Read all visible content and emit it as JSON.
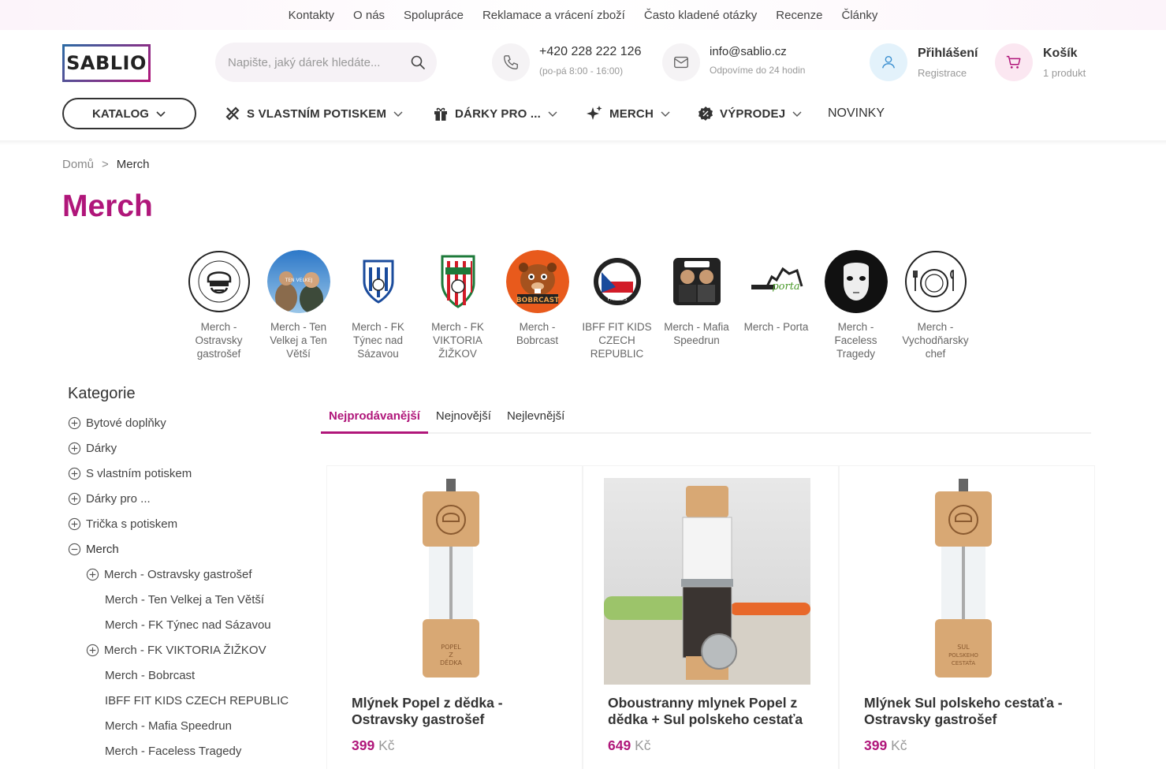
{
  "topbar": {
    "links": [
      "Kontakty",
      "O nás",
      "Spolupráce",
      "Reklamace a vrácení zboží",
      "Často kladené otázky",
      "Recenze",
      "Články"
    ]
  },
  "header": {
    "logo": "SABLIO",
    "search_placeholder": "Napište, jaký dárek hledáte...",
    "phone": "+420 228 222 126",
    "phone_hours": "(po-pá 8:00 - 16:00)",
    "email": "info@sablio.cz",
    "email_note": "Odpovíme do 24 hodin",
    "login": "Přihlášení",
    "register": "Registrace",
    "cart": "Košík",
    "cart_count": "1 produkt"
  },
  "nav": {
    "catalog": "KATALOG",
    "items": [
      "S VLASTNÍM POTISKEM",
      "DÁRKY PRO ...",
      "MERCH",
      "VÝPRODEJ",
      "NOVINKY"
    ]
  },
  "breadcrumb": {
    "home": "Domů",
    "separator": ">",
    "current": "Merch"
  },
  "page_title": "Merch",
  "subcategories": [
    {
      "label": "Merch - Ostravsky gastrošef",
      "icon": "chef-logo-icon"
    },
    {
      "label": "Merch - Ten Velkej a Ten Větší",
      "icon": "podcast-photo-icon"
    },
    {
      "label": "Merch - FK Týnec nad Sázavou",
      "icon": "fk-tynec-crest-icon"
    },
    {
      "label": "Merch - FK VIKTORIA ŽIŽKOV",
      "icon": "viktoria-zizkov-crest-icon"
    },
    {
      "label": "Merch - Bobrcast",
      "icon": "bobrcast-beaver-icon"
    },
    {
      "label": "IBFF FIT KIDS CZECH REPUBLIC",
      "icon": "fit-kids-badge-icon"
    },
    {
      "label": "Merch - Mafia Speedrun",
      "icon": "mafia-speedrun-icon"
    },
    {
      "label": "Merch - Porta",
      "icon": "porta-logo-icon"
    },
    {
      "label": "Merch - Faceless Tragedy",
      "icon": "mask-icon"
    },
    {
      "label": "Merch - Vychodňarsky chef",
      "icon": "plate-cutlery-icon"
    }
  ],
  "sidebar": {
    "title": "Kategorie",
    "categories": [
      "Bytové doplňky",
      "Dárky",
      "S vlastním potiskem",
      "Dárky pro ...",
      "Trička s potiskem",
      "Merch"
    ],
    "merch_children": [
      "Merch - Ostravsky gastrošef",
      "Merch - Ten Velkej a Ten Větší",
      "Merch - FK Týnec nad Sázavou",
      "Merch - FK VIKTORIA ŽIŽKOV",
      "Merch - Bobrcast",
      "IBFF FIT KIDS CZECH REPUBLIC",
      "Merch - Mafia Speedrun",
      "Merch - Faceless Tragedy"
    ]
  },
  "sort_tabs": [
    "Nejprodávanější",
    "Nejnovější",
    "Nejlevnější"
  ],
  "products": [
    {
      "name": "Mlýnek Popel z dědka - Ostravsky gastrošef",
      "price": "399",
      "currency": "Kč"
    },
    {
      "name": "Oboustranny mlynek Popel z dědka + Sul polskeho cestaťa",
      "price": "649",
      "currency": "Kč"
    },
    {
      "name": "Mlýnek Sul polskeho cestaťa - Ostravsky gastrošef",
      "price": "399",
      "currency": "Kč"
    }
  ],
  "colors": {
    "accent": "#b0167a",
    "logo_blue": "#2d6aa3",
    "text": "#333333"
  }
}
